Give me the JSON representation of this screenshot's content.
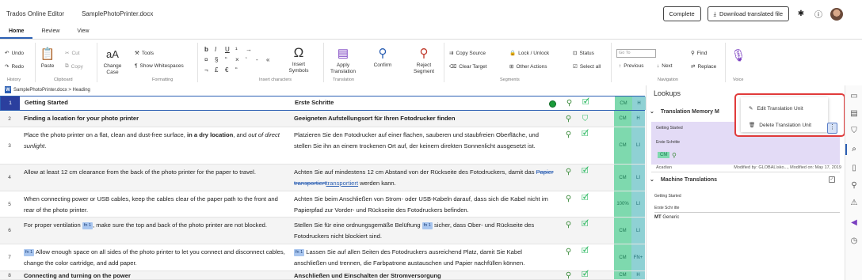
{
  "titlebar": {
    "app_title": "Trados Online Editor",
    "doc_title": "SamplePhotoPrinter.docx",
    "complete_label": "Complete",
    "download_label": "Download translated file"
  },
  "tabs": [
    {
      "label": "Home",
      "active": true
    },
    {
      "label": "Review",
      "active": false
    },
    {
      "label": "View",
      "active": false
    }
  ],
  "ribbon": {
    "history": {
      "undo": "Undo",
      "redo": "Redo",
      "label": "History"
    },
    "clipboard": {
      "paste": "Paste",
      "cut": "Cut",
      "copy": "Copy",
      "label": "Clipboard"
    },
    "formatting": {
      "change_case": "Change Case",
      "tools": "Tools",
      "show_whitespaces": "Show Whitespaces",
      "label": "Formatting"
    },
    "insert": {
      "insert_symbols": "Insert Symbols",
      "label": "Insert characters",
      "glyphs": [
        "b",
        "I",
        "U",
        "¹",
        "¤",
        "§",
        "“",
        "×",
        "‘",
        "-",
        "«",
        "→",
        "¬",
        "£",
        "€",
        "“"
      ]
    },
    "translation": {
      "apply": "Apply Translation",
      "confirm": "Confirm",
      "reject": "Reject Segment",
      "label": "Translation"
    },
    "segments": {
      "copy_source": "Copy Source",
      "clear_target": "Clear Target",
      "lock_unlock": "Lock / Unlock",
      "other_actions": "Other Actions",
      "status": "Status",
      "select_all": "Select all",
      "label": "Segments"
    },
    "navigation": {
      "goto_placeholder": "Go To",
      "previous": "Previous",
      "next": "Next",
      "find": "Find",
      "replace": "Replace",
      "label": "Navigation"
    },
    "voice": {
      "label": "Voice"
    }
  },
  "breadcrumb": {
    "text": "SamplePhotoPrinter.docx > Heading"
  },
  "segments": [
    {
      "num": "1",
      "src": "Getting Started",
      "tgt": "Erste Schritte",
      "cm": "CM",
      "st": "H"
    },
    {
      "num": "2",
      "src": "Finding a location for your photo printer",
      "tgt": "Geeigneten Aufstellungsort für Ihren Fotodrucker finden",
      "cm": "CM",
      "st": "H"
    },
    {
      "num": "3",
      "src_a": "Place the photo printer on a flat, clean and dust-free surface, ",
      "src_b": "in a dry location",
      "src_c": ", and ",
      "src_d": "out of direct sunlight",
      "src_e": ".",
      "tgt": "Platzieren Sie den Fotodrucker auf einer flachen, sauberen und staubfreien Oberfläche, und stellen Sie ihn an einem trockenen Ort auf, der keinem direkten Sonnenlicht ausgesetzt ist.",
      "cm": "CM",
      "st": "LI"
    },
    {
      "num": "4",
      "src": "Allow at least 12 cm clearance from the back of the photo printer for the paper to travel.",
      "tgt_a": "Achten Sie auf mindestens 12 cm Abstand von der Rückseite des Fotodruckers, damit das ",
      "tgt_del": "Papier transportiert",
      "tgt_ins": "transportiert",
      "tgt_b": " werden kann.",
      "cm": "CM",
      "st": "LI"
    },
    {
      "num": "5",
      "src": "When connecting power or USB cables, keep the cables clear of the paper path to the front and rear of the photo printer.",
      "tgt": "Achten Sie beim Anschließen von Strom- oder USB-Kabeln darauf, dass sich die Kabel nicht im Papierpfad zur Vorder- und Rückseite des Fotodruckers befinden.",
      "cm": "100%",
      "st": "LI"
    },
    {
      "num": "6",
      "src_a": "For proper ventilation ",
      "src_tag": "fn 1",
      "src_b": ", make sure the top and back of the photo printer are not blocked.",
      "tgt_a": "Stellen Sie für eine ordnungsgemäße Belüftung ",
      "tgt_tag": "fn 1",
      "tgt_b": " sicher, dass Ober- und Rückseite des Fotodruckers nicht blockiert sind.",
      "cm": "CM",
      "st": "LI"
    },
    {
      "num": "7",
      "src_tag": "fn 1",
      "src": " Allow enough space on all sides of the photo printer to let you connect and disconnect cables, change the color cartridge, and add paper.",
      "tgt_tag": "fn 1",
      "tgt": " Lassen Sie auf allen Seiten des Fotodruckers ausreichend Platz, damit Sie Kabel anschließen und trennen, die Farbpatrone austauschen und Papier nachfüllen können.",
      "cm": "CM",
      "st": "FN+"
    },
    {
      "num": "8",
      "src": "Connecting and turning on the power",
      "tgt": "Anschließen und Einschalten der Stromversorgung",
      "cm": "CM",
      "st": "H"
    }
  ],
  "lookups": {
    "title": "Lookups",
    "tm_header": "Translation Memory M",
    "tm_source": "Getting Started",
    "tm_target": "Erste Schritte",
    "tm_cm": "CM",
    "tm_meta_left": "Acadian",
    "tm_meta_right": "Modified by: GLOBAL\\sko..., Modified on: May 17, 2019",
    "mt_header": "Machine Translations",
    "mt_source": "Getting Started",
    "mt_target": "Erste Schr itte",
    "mt_label": "MT",
    "mt_engine": "Generic"
  },
  "context_menu": {
    "edit": "Edit Translation Unit",
    "delete": "Delete Translation Unit",
    "more": "⋮"
  },
  "colors": {
    "accent": "#2b5fb3",
    "cm_green": "#7ed9ae",
    "status_teal": "#8fd1d4",
    "highlight_red": "#e03b3b"
  }
}
